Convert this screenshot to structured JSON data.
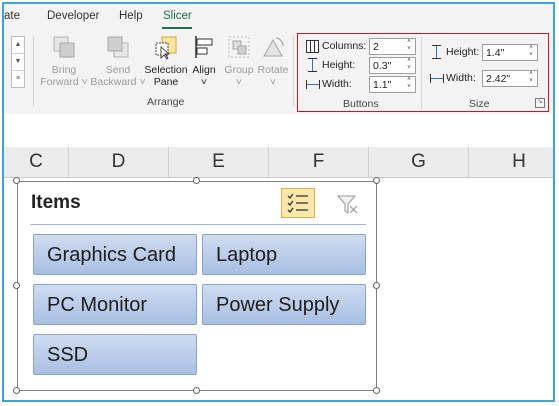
{
  "ribbon_tabs": {
    "tab1": "ate",
    "tab2": "Developer",
    "tab3": "Help",
    "tab4": "Slicer"
  },
  "arrange": {
    "bring_forward": {
      "line1": "Bring",
      "line2": "Forward ˅"
    },
    "send_backward": {
      "line1": "Send",
      "line2": "Backward ˅"
    },
    "selection_pane": {
      "line1": "Selection",
      "line2": "Pane"
    },
    "align": {
      "line1": "Align",
      "line2": "˅"
    },
    "group": {
      "line1": "Group",
      "line2": "˅"
    },
    "rotate": {
      "line1": "Rotate",
      "line2": "˅"
    },
    "label": "Arrange"
  },
  "buttons_group": {
    "columns_label": "Columns:",
    "columns_value": "2",
    "height_label": "Height:",
    "height_value": "0.3\"",
    "width_label": "Width:",
    "width_value": "1.1\"",
    "label": "Buttons"
  },
  "size_group": {
    "height_label": "Height:",
    "height_value": "1.4\"",
    "width_label": "Width:",
    "width_value": "2.42\"",
    "label": "Size"
  },
  "columns": [
    "C",
    "D",
    "E",
    "F",
    "G",
    "H"
  ],
  "slicer": {
    "title": "Items",
    "items": [
      "Graphics Card",
      "Laptop",
      "PC Monitor",
      "Power Supply",
      "SSD"
    ]
  }
}
